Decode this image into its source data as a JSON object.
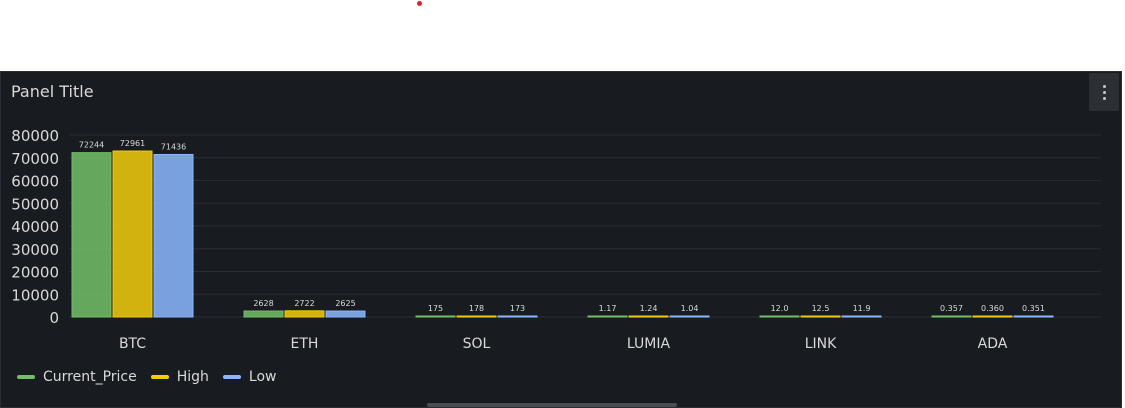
{
  "panel": {
    "title": "Panel Title",
    "menu_icon": "kebab-menu-icon"
  },
  "colors": {
    "Current_Price": "#73bf69",
    "High": "#f2cc0c",
    "Low": "#8ab8ff"
  },
  "chart_data": {
    "type": "bar",
    "categories": [
      "BTC",
      "ETH",
      "SOL",
      "LUMIA",
      "LINK",
      "ADA"
    ],
    "series": [
      {
        "name": "Current_Price",
        "values": [
          72244,
          2628,
          175,
          1.17,
          12.0,
          0.357
        ],
        "labels": [
          "72244",
          "2628",
          "175",
          "1.17",
          "12.0",
          "0.357"
        ]
      },
      {
        "name": "High",
        "values": [
          72961,
          2722,
          178,
          1.24,
          12.5,
          0.36
        ],
        "labels": [
          "72961",
          "2722",
          "178",
          "1.24",
          "12.5",
          "0.360"
        ]
      },
      {
        "name": "Low",
        "values": [
          71436,
          2625,
          173,
          1.04,
          11.9,
          0.351
        ],
        "labels": [
          "71436",
          "2625",
          "173",
          "1.04",
          "11.9",
          "0.351"
        ]
      }
    ],
    "ylim": [
      0,
      80000
    ],
    "yticks": [
      "0",
      "10000",
      "20000",
      "30000",
      "40000",
      "50000",
      "60000",
      "70000",
      "80000"
    ],
    "grid": true,
    "legend": "bottom-left"
  }
}
